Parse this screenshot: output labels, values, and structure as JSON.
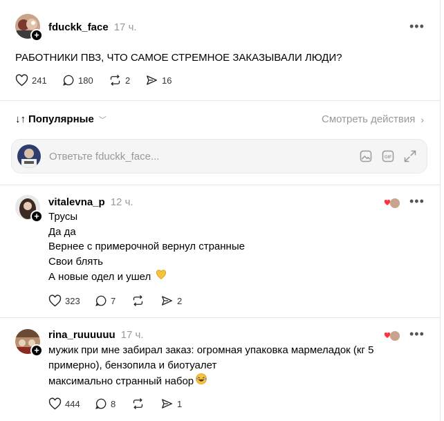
{
  "post": {
    "username": "fduckk_face",
    "time": "17 ч.",
    "text": "РАБОТНИКИ ПВЗ, ЧТО САМОЕ СТРЕМНОЕ ЗАКАЗЫВАЛИ ЛЮДИ?",
    "likes": "241",
    "comments": "180",
    "reposts": "2",
    "shares": "16"
  },
  "sort": {
    "label": "Популярные",
    "view_activity": "Смотреть действия"
  },
  "reply": {
    "placeholder": "Ответьте fduckk_face..."
  },
  "comments": [
    {
      "username": "vitalevna_p",
      "time": "12 ч.",
      "lines": [
        "Трусы",
        "Да да",
        "Вернее с примерочной вернул странные",
        "Свои блять",
        "А новые одел и ушел"
      ],
      "likes": "323",
      "comments": "7",
      "reposts": "",
      "shares": "2"
    },
    {
      "username": "rina_ruuuuuu",
      "time": "17 ч.",
      "lines": [
        "мужик при мне забирал заказ: огромная упаковка мармеладок (кг 5",
        "примерно), бензопила и биотуалет",
        "максимально странный набор"
      ],
      "likes": "444",
      "comments": "8",
      "reposts": "",
      "shares": "1"
    }
  ],
  "colors": {
    "heart_accent": "#ff3040",
    "muted": "#999999"
  }
}
